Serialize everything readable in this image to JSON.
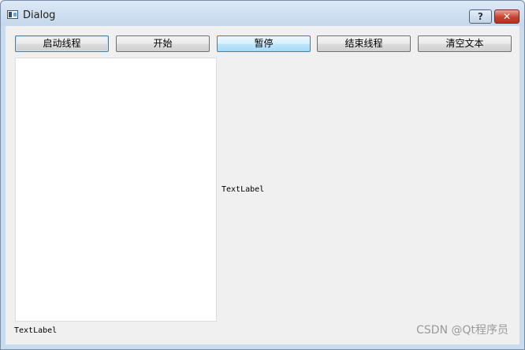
{
  "window": {
    "title": "Dialog",
    "help_label": "?",
    "close_label": "✕"
  },
  "toolbar": {
    "start_thread": "启动线程",
    "begin": "开始",
    "pause": "暂停",
    "stop_thread": "结束线程",
    "clear_text": "清空文本"
  },
  "text_area": {
    "value": ""
  },
  "labels": {
    "middle": "TextLabel",
    "bottom": "TextLabel"
  },
  "watermark": "CSDN @Qt程序员",
  "icons": {
    "app": "window-app-icon",
    "help": "help-icon",
    "close": "close-icon"
  }
}
